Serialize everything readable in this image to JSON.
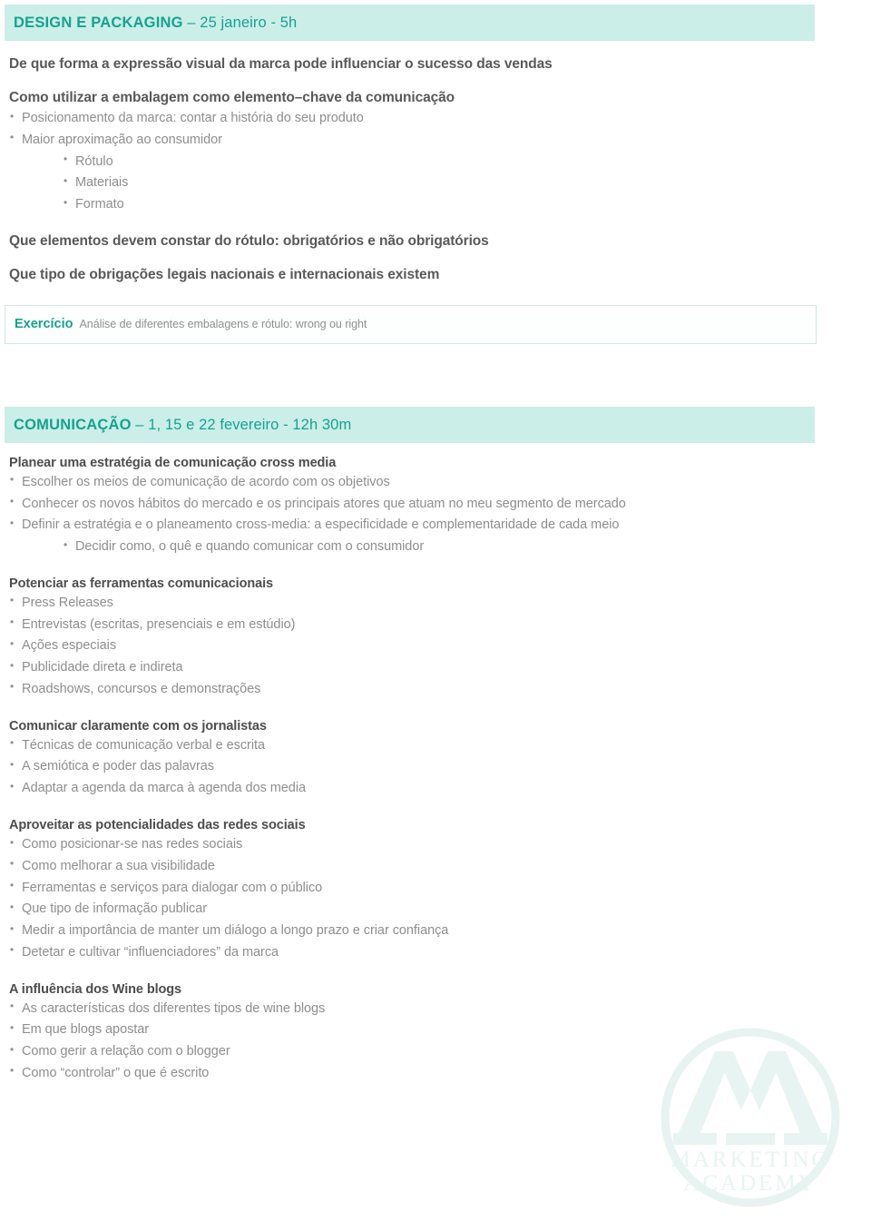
{
  "document": {
    "type": "course-programme",
    "language": "pt-PT"
  },
  "theme": {
    "band_background": "#cbeee9",
    "accent_teal": "#16a28e",
    "heading_gray": "#59595b",
    "body_gray": "#8e8e90",
    "exercise_border": "#cfe8e4",
    "watermark_color": "#e9f4f2"
  },
  "watermark": {
    "icon": "marketing-academy-monogram-icon",
    "line1": "MARKETING",
    "line2": "ACADEMY"
  },
  "sections": [
    {
      "id": "design-e-packaging",
      "band": {
        "title": "DESIGN E PACKAGING",
        "meta": " – 25 janeiro - 5h"
      },
      "lead": "De que forma a expressão visual da marca pode influenciar o sucesso das vendas",
      "sub_head": "Como utilizar a embalagem como elemento–chave da comunicação",
      "bullets": [
        {
          "text": "Posicionamento da marca: contar a história do seu produto",
          "level": 1
        },
        {
          "text": "Maior aproximação ao consumidor",
          "level": 1
        },
        {
          "text": "Rótulo",
          "level": 2
        },
        {
          "text": "Materiais",
          "level": 2
        },
        {
          "text": "Formato",
          "level": 2
        }
      ],
      "closing_heads": [
        "Que elementos devem constar do rótulo: obrigatórios e não obrigatórios",
        "Que tipo de obrigações legais nacionais e internacionais existem"
      ],
      "exercise": {
        "label": "Exercício",
        "text": "Análise de diferentes embalagens e rótulo: wrong ou right"
      }
    },
    {
      "id": "comunicacao",
      "band": {
        "title": "COMUNICAÇÃO",
        "meta": "  –  1, 15 e 22 fevereiro - 12h 30m"
      },
      "groups": [
        {
          "head": "Planear uma estratégia de comunicação cross media",
          "bullets": [
            {
              "text": "Escolher os meios de comunicação de acordo com os objetivos",
              "level": 1
            },
            {
              "text": "Conhecer os novos hábitos do mercado e os principais atores que atuam no meu segmento de mercado",
              "level": 1
            },
            {
              "text": "Definir a estratégia e o planeamento cross-media: a especificidade e complementaridade de cada meio",
              "level": 1
            },
            {
              "text": "Decidir como, o quê e quando comunicar com o consumidor",
              "level": 2
            }
          ]
        },
        {
          "head": "Potenciar as ferramentas comunicacionais",
          "bullets": [
            {
              "text": "Press Releases",
              "level": 1
            },
            {
              "text": "Entrevistas (escritas, presenciais e em estúdio)",
              "level": 1
            },
            {
              "text": "Ações especiais",
              "level": 1
            },
            {
              "text": "Publicidade direta e indireta",
              "level": 1
            },
            {
              "text": "Roadshows, concursos e demonstrações",
              "level": 1
            }
          ]
        },
        {
          "head": "Comunicar claramente com os jornalistas",
          "bullets": [
            {
              "text": "Técnicas de comunicação verbal e escrita",
              "level": 1
            },
            {
              "text": "A semiótica e poder das palavras",
              "level": 1
            },
            {
              "text": "Adaptar a agenda da marca à agenda dos media",
              "level": 1
            }
          ]
        },
        {
          "head": "Aproveitar as potencialidades das redes sociais",
          "bullets": [
            {
              "text": "Como posicionar-se nas redes sociais",
              "level": 1
            },
            {
              "text": "Como melhorar a sua visibilidade",
              "level": 1
            },
            {
              "text": "Ferramentas e serviços para dialogar com o público",
              "level": 1
            },
            {
              "text": "Que tipo de informação publicar",
              "level": 1
            },
            {
              "text": "Medir a importância de manter um diálogo a longo prazo e criar confiança",
              "level": 1
            },
            {
              "text": "Detetar e cultivar “influenciadores” da marca",
              "level": 1
            }
          ]
        },
        {
          "head": "A influência dos Wine blogs",
          "bullets": [
            {
              "text": "As características dos diferentes tipos de wine blogs",
              "level": 1
            },
            {
              "text": "Em que blogs apostar",
              "level": 1
            },
            {
              "text": "Como gerir a relação com o blogger",
              "level": 1
            },
            {
              "text": "Como “controlar” o que é escrito",
              "level": 1
            }
          ]
        }
      ]
    }
  ]
}
